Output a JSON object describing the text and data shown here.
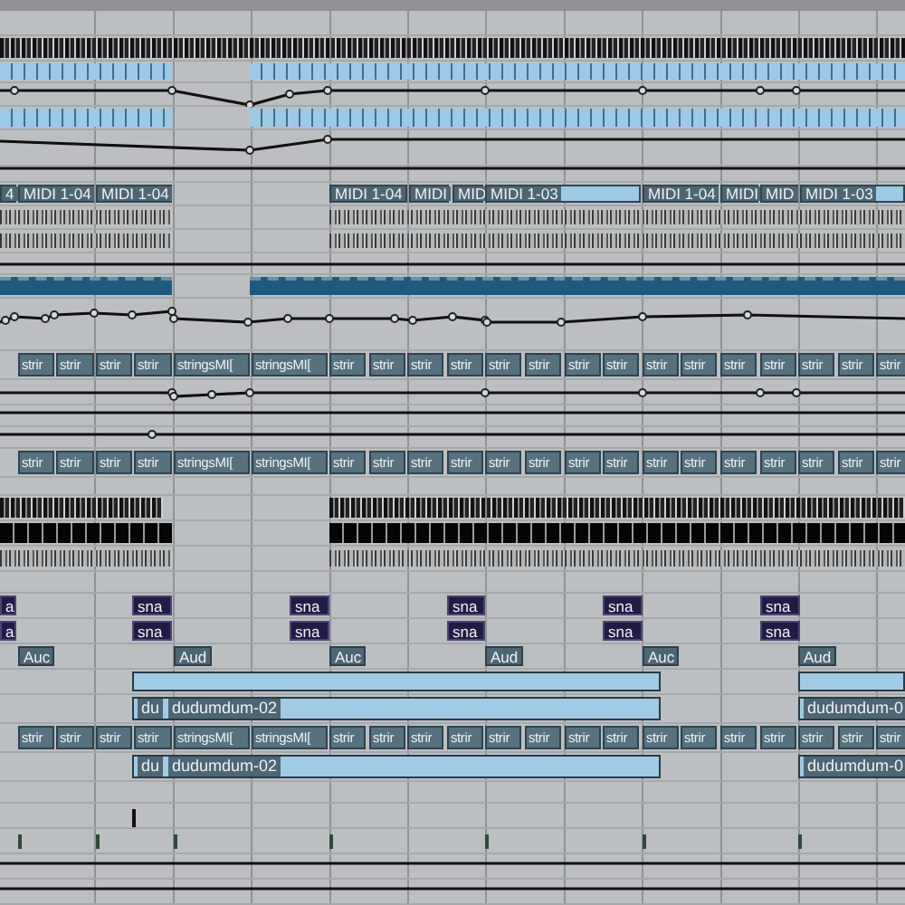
{
  "tracks": [
    {
      "kind": "ruler"
    },
    {
      "kind": "notes"
    },
    {
      "kind": "blueblocks"
    },
    {
      "kind": "automation"
    },
    {
      "kind": "blueblocks"
    },
    {
      "kind": "automation"
    },
    {
      "kind": "automation"
    },
    {
      "kind": "midi",
      "clips": [
        {
          "label": "4"
        },
        {
          "label": "MIDI 1-04"
        },
        {
          "label": "MIDI 1-04"
        },
        {
          "label": "MIDI 1-04"
        },
        {
          "label": "MIDI"
        },
        {
          "label": "MID"
        },
        {
          "label": "MIDI 1-03"
        },
        {
          "label": "MIDI 1-04"
        },
        {
          "label": "MIDI"
        },
        {
          "label": "MID"
        },
        {
          "label": "MIDI 1-03"
        }
      ]
    },
    {
      "kind": "greypattern"
    },
    {
      "kind": "greypattern"
    },
    {
      "kind": "automation"
    },
    {
      "kind": "darkbar"
    },
    {
      "kind": "automation"
    },
    {
      "kind": "strings",
      "clips": [
        {
          "label": "strir"
        },
        {
          "label": "strir"
        },
        {
          "label": "strir"
        },
        {
          "label": "strir"
        },
        {
          "label": "stringsMI["
        },
        {
          "label": "stringsMI["
        },
        {
          "label": "strir"
        },
        {
          "label": "strir"
        },
        {
          "label": "strir"
        },
        {
          "label": "strir"
        },
        {
          "label": "strir"
        },
        {
          "label": "strir"
        },
        {
          "label": "strir"
        },
        {
          "label": "strir"
        },
        {
          "label": "strir"
        },
        {
          "label": "strir"
        },
        {
          "label": "strir"
        },
        {
          "label": "strir"
        },
        {
          "label": "strir"
        },
        {
          "label": "strir"
        },
        {
          "label": "strir"
        }
      ]
    },
    {
      "kind": "automation"
    },
    {
      "kind": "automation"
    },
    {
      "kind": "automation"
    },
    {
      "kind": "strings",
      "clips": [
        {
          "label": "strir"
        },
        {
          "label": "strir"
        },
        {
          "label": "strir"
        },
        {
          "label": "strir"
        },
        {
          "label": "stringsMI["
        },
        {
          "label": "stringsMI["
        },
        {
          "label": "strir"
        },
        {
          "label": "strir"
        },
        {
          "label": "strir"
        },
        {
          "label": "strir"
        },
        {
          "label": "strir"
        },
        {
          "label": "strir"
        },
        {
          "label": "strir"
        },
        {
          "label": "strir"
        },
        {
          "label": "strir"
        },
        {
          "label": "strir"
        },
        {
          "label": "strir"
        },
        {
          "label": "strir"
        },
        {
          "label": "strir"
        },
        {
          "label": "strir"
        },
        {
          "label": "strir"
        }
      ]
    },
    {
      "kind": "empty"
    },
    {
      "kind": "notes"
    },
    {
      "kind": "blackblocks"
    },
    {
      "kind": "greypattern"
    },
    {
      "kind": "empty"
    },
    {
      "kind": "snare",
      "clips": [
        {
          "label": "a"
        },
        {
          "label": "sna"
        },
        {
          "label": "sna"
        },
        {
          "label": "sna"
        },
        {
          "label": "sna"
        },
        {
          "label": "sna"
        }
      ]
    },
    {
      "kind": "snare",
      "clips": [
        {
          "label": "a"
        },
        {
          "label": "sna"
        },
        {
          "label": "sna"
        },
        {
          "label": "sna"
        },
        {
          "label": "sna"
        },
        {
          "label": "sna"
        }
      ]
    },
    {
      "kind": "audiolabel",
      "clips": [
        {
          "label": "Auc"
        },
        {
          "label": "Aud"
        },
        {
          "label": "Auc"
        },
        {
          "label": "Aud"
        },
        {
          "label": "Auc"
        },
        {
          "label": "Aud"
        }
      ]
    },
    {
      "kind": "audio"
    },
    {
      "kind": "audionamed",
      "clips": [
        {
          "tag": "du",
          "label": "dudumdum-02"
        },
        {
          "label": "dudumdum-0"
        }
      ]
    },
    {
      "kind": "strings",
      "clips": [
        {
          "label": "strir"
        },
        {
          "label": "strir"
        },
        {
          "label": "strir"
        },
        {
          "label": "strir"
        },
        {
          "label": "stringsMI["
        },
        {
          "label": "stringsMI["
        },
        {
          "label": "strir"
        },
        {
          "label": "strir"
        },
        {
          "label": "strir"
        },
        {
          "label": "strir"
        },
        {
          "label": "strir"
        },
        {
          "label": "strir"
        },
        {
          "label": "strir"
        },
        {
          "label": "strir"
        },
        {
          "label": "strir"
        },
        {
          "label": "strir"
        },
        {
          "label": "strir"
        },
        {
          "label": "strir"
        },
        {
          "label": "strir"
        },
        {
          "label": "strir"
        },
        {
          "label": "strir"
        }
      ]
    },
    {
      "kind": "audionamed",
      "clips": [
        {
          "tag": "du",
          "label": "dudumdum-02"
        },
        {
          "label": "dudumdum-0"
        }
      ]
    },
    {
      "kind": "empty"
    },
    {
      "kind": "marks"
    },
    {
      "kind": "marks"
    },
    {
      "kind": "automation"
    },
    {
      "kind": "automation"
    }
  ]
}
